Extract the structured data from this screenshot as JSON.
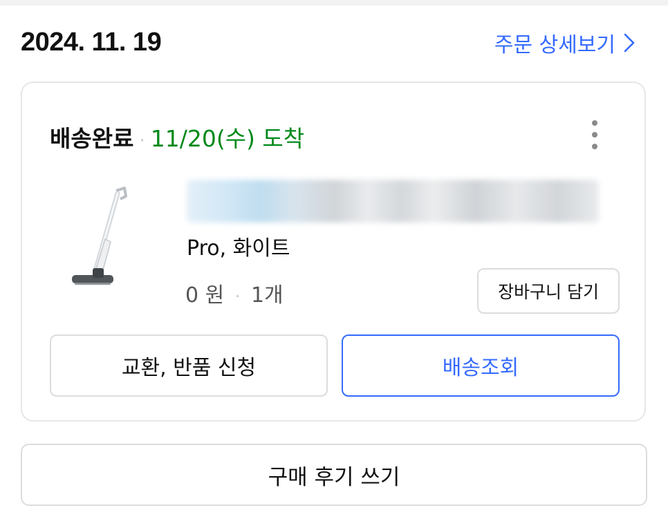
{
  "order": {
    "date": "2024. 11. 19",
    "detail_link_label": "주문 상세보기"
  },
  "card": {
    "status": "배송완료",
    "status_separator": "·",
    "arrival": "11/20(수) 도착",
    "product": {
      "image_icon": "cordless-wet-dry-vacuum-icon",
      "option": "Pro, 화이트",
      "price": "0 원",
      "quantity": "1개",
      "price_separator": "·"
    },
    "add_to_cart_label": "장바구니 담기",
    "exchange_return_label": "교환, 반품 신청",
    "track_delivery_label": "배송조회"
  },
  "review_button_label": "구매 후기 쓰기",
  "colors": {
    "accent_blue": "#346aff",
    "delivered_green": "#00891a",
    "border_gray": "#dcdcdc"
  }
}
